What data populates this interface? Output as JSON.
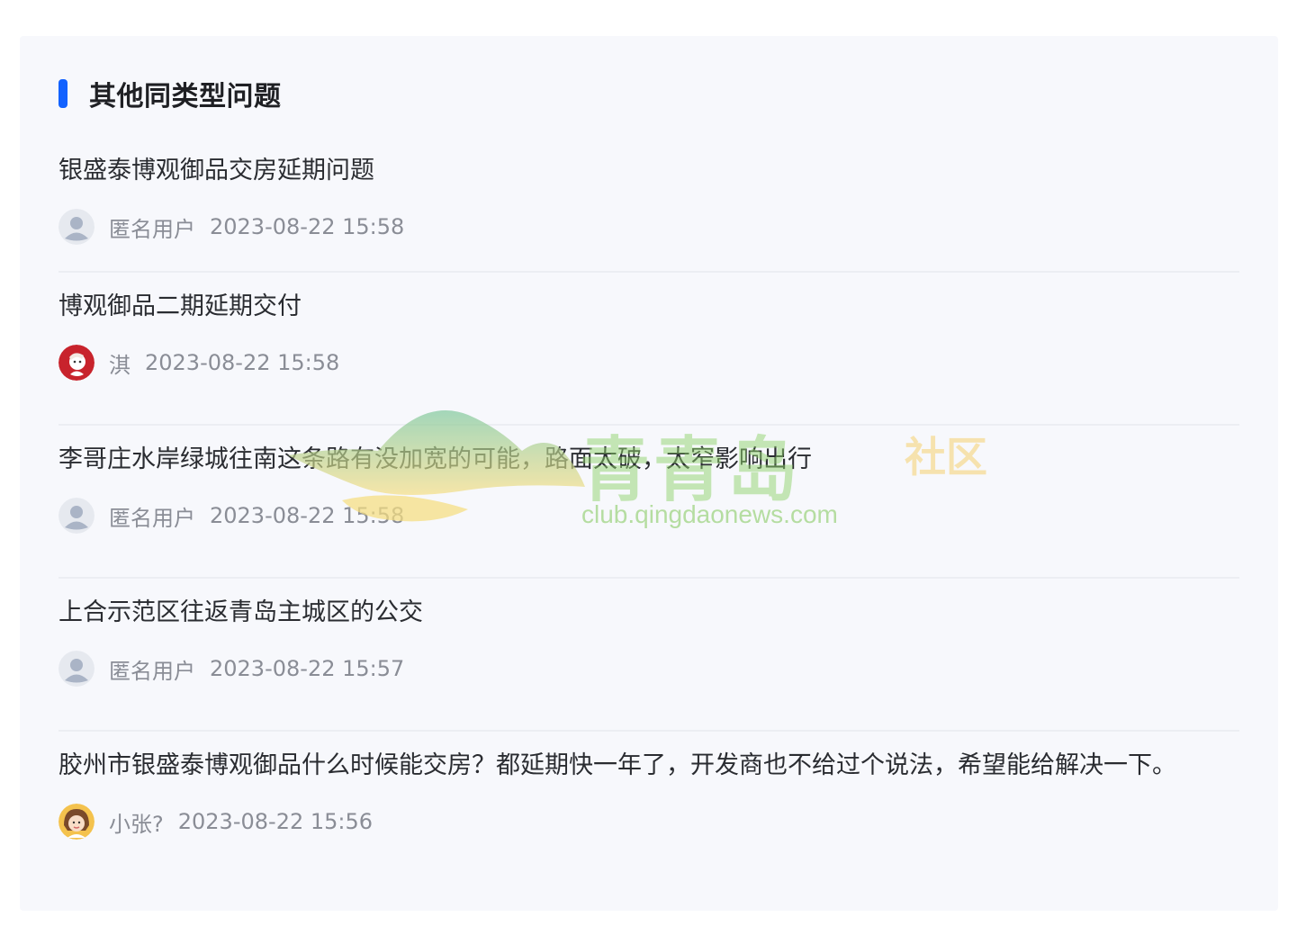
{
  "section": {
    "title": "其他同类型问题"
  },
  "questions": [
    {
      "title": "银盛泰博观御品交房延期问题",
      "author": "匿名用户",
      "time": "2023-08-22 15:58",
      "avatar": "default-user-avatar"
    },
    {
      "title": "博观御品二期延期交付",
      "author": "淇",
      "time": "2023-08-22 15:58",
      "avatar": "cartoon-avatar-red"
    },
    {
      "title": "李哥庄水岸绿城往南这条路有没加宽的可能，路面太破，太窄影响出行",
      "author": "匿名用户",
      "time": "2023-08-22 15:58",
      "avatar": "default-user-avatar"
    },
    {
      "title": "上合示范区往返青岛主城区的公交",
      "author": "匿名用户",
      "time": "2023-08-22 15:57",
      "avatar": "default-user-avatar"
    },
    {
      "title": "胶州市银盛泰博观御品什么时候能交房？都延期快一年了，开发商也不给过个说法，希望能给解决一下。",
      "author": "小张?",
      "time": "2023-08-22 15:56",
      "avatar": "cartoon-avatar-girl"
    }
  ],
  "watermark": {
    "brand": "青青岛",
    "sub": "社区",
    "url": "club.qingdaonews.com"
  },
  "colors": {
    "accent": "#1262ff",
    "panel_bg": "#f7f8fc",
    "title_text": "#2a2c31",
    "meta_text": "#8a8d96",
    "divider": "#eceef3"
  }
}
